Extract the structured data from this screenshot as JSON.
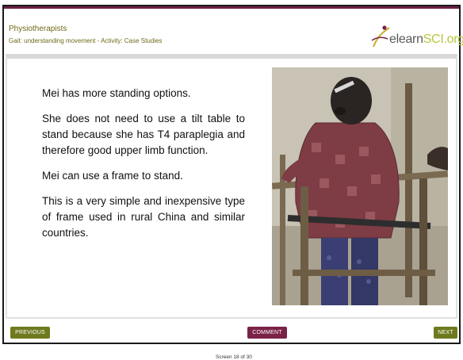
{
  "header": {
    "title": "Physiotherapists",
    "subtitle": "Gait: understanding movement - Activity: Case Studies",
    "logo": {
      "prefix": "elearn",
      "suffix": "SCI.org"
    }
  },
  "slide": {
    "paragraphs": [
      "Mei has more standing options.",
      "She does not need to use a tilt table to stand because she has T4 paraplegia and therefore good upper limb function.",
      "Mei can use a frame to stand.",
      "This is a very simple and inexpensive type of frame used in rural China and similar countries."
    ],
    "screen_counter": "Screen 18 of 30"
  },
  "navigation": {
    "previous_label": "PREVIOUS",
    "comment_label": "COMMENT",
    "next_label": "NEXT"
  },
  "colors": {
    "header_text": "#6f6a1a",
    "header_rule": "#6d1f44",
    "nav_button": "#6f7a1f",
    "comment_button": "#7a2248",
    "logo_accent": "#b8c63a"
  }
}
